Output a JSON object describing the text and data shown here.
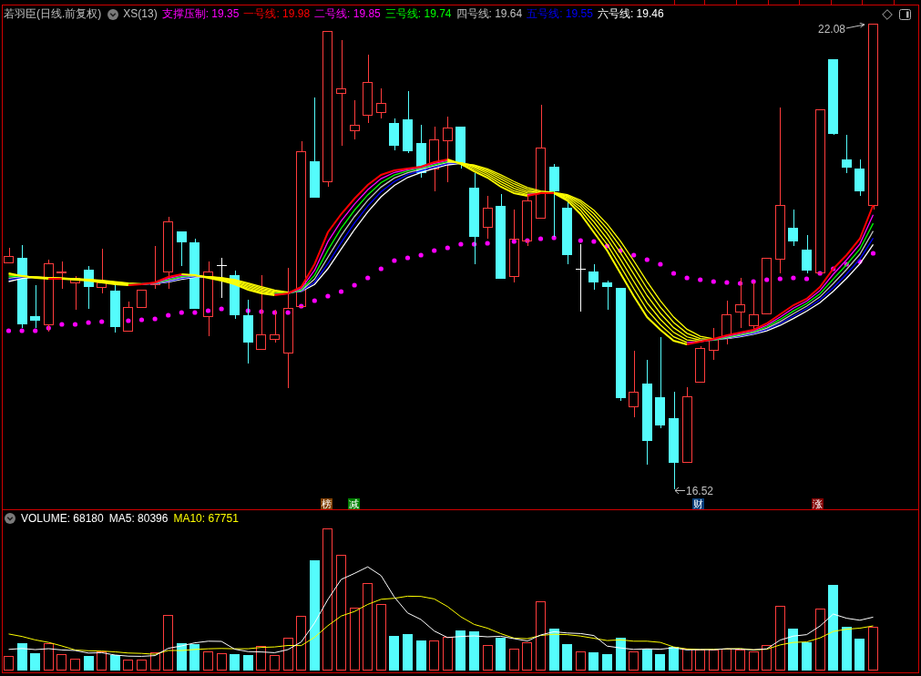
{
  "header": {
    "title": "若羽臣(日线.前复权)",
    "indicator": "XS(13)",
    "legend": [
      {
        "text": "支撑压制: 19.35",
        "color": "#ff00ff"
      },
      {
        "text": "一号线: 19.98",
        "color": "#ff0000"
      },
      {
        "text": "二号线: 19.85",
        "color": "#ff00ff"
      },
      {
        "text": "三号线: 19.74",
        "color": "#00ff00"
      },
      {
        "text": "四号线: 19.64",
        "color": "#c0c0c0"
      },
      {
        "text": "五号线: 19.55",
        "color": "#0000ff"
      },
      {
        "text": "六号线: 19.46",
        "color": "#ffffff"
      }
    ]
  },
  "price_chart": {
    "high_label": "22.08",
    "low_label": "16.52",
    "markers": [
      {
        "text": "榜",
        "color": "#804000"
      },
      {
        "text": "减",
        "color": "#008000"
      },
      {
        "text": "财",
        "color": "#003c78"
      },
      {
        "text": "涨",
        "color": "#800000"
      }
    ]
  },
  "volume_panel": {
    "legend": [
      {
        "text": "VOLUME: 68180",
        "color": "#ffffff"
      },
      {
        "text": "MA5: 80396",
        "color": "#ffffff"
      },
      {
        "text": "MA10: 67751",
        "color": "#ffff00"
      }
    ]
  }
}
